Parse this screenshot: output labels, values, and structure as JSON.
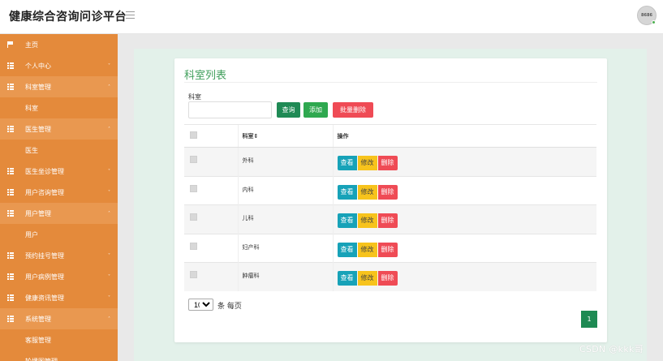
{
  "header": {
    "title": "健康综合咨询问诊平台",
    "avatar_text": "8686"
  },
  "sidebar": {
    "items": [
      {
        "label": "主页",
        "icon": "flag-icon",
        "expanded": false
      },
      {
        "label": "个人中心",
        "icon": "grid-icon",
        "caret": "˅"
      },
      {
        "label": "科室管理",
        "icon": "grid-icon",
        "caret": "˄",
        "open": true
      },
      {
        "label": "科室",
        "sub": true
      },
      {
        "label": "医生管理",
        "icon": "grid-icon",
        "caret": "˄",
        "open": true
      },
      {
        "label": "医生",
        "sub": true
      },
      {
        "label": "医生坐诊管理",
        "icon": "grid-icon",
        "caret": "˅"
      },
      {
        "label": "用户咨询管理",
        "icon": "grid-icon",
        "caret": "˅"
      },
      {
        "label": "用户管理",
        "icon": "grid-icon",
        "caret": "˄",
        "open": true
      },
      {
        "label": "用户",
        "sub": true
      },
      {
        "label": "预约挂号管理",
        "icon": "grid-icon",
        "caret": "˅"
      },
      {
        "label": "用户病例管理",
        "icon": "grid-icon",
        "caret": "˅"
      },
      {
        "label": "健康资讯管理",
        "icon": "grid-icon",
        "caret": "˅"
      },
      {
        "label": "系统管理",
        "icon": "grid-icon",
        "caret": "˄",
        "open": true
      },
      {
        "label": "客服管理",
        "sub": true
      },
      {
        "label": "轮播图管理",
        "sub": true
      }
    ]
  },
  "panel": {
    "title": "科室列表",
    "search_label": "科室",
    "search_value": "",
    "search_placeholder": "",
    "btn_query": "查询",
    "btn_add": "添加",
    "btn_bulk_delete": "批量删除"
  },
  "table": {
    "headers": {
      "name": "科室",
      "sort_icon": "⇕",
      "actions": "操作"
    },
    "rows": [
      {
        "name": "外科"
      },
      {
        "name": "内科"
      },
      {
        "name": "儿科"
      },
      {
        "name": "妇产科"
      },
      {
        "name": "肿瘤科"
      }
    ],
    "action_labels": {
      "view": "查看",
      "edit": "修改",
      "delete": "删除"
    }
  },
  "pagination": {
    "page_size": "10",
    "page_size_suffix": "条 每页",
    "current_page": "1"
  },
  "watermark": "CSDN @kkk哥",
  "colors": {
    "sidebar": "#e48a3b",
    "accent_green": "#1f8a55",
    "delete_red": "#ef4b55",
    "view_teal": "#17a2b8",
    "edit_yellow": "#f7c31c"
  }
}
